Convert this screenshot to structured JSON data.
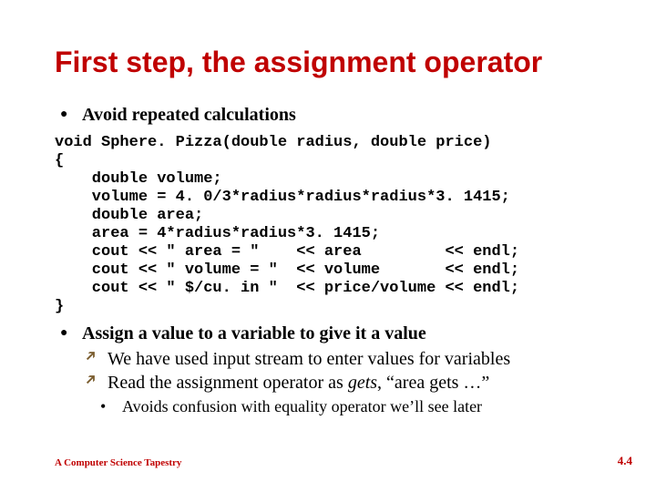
{
  "title": "First step, the assignment operator",
  "bullets": {
    "b1": "Avoid repeated calculations",
    "b2": "Assign a value to a variable to give it a value",
    "b2_sub1": "We have used input stream to enter values for variables",
    "b2_sub2_lead": "Read the assignment operator as ",
    "b2_sub2_gets": "gets",
    "b2_sub2_tail": ", “area gets …”",
    "b2_sub3": "Avoids confusion with equality operator we’ll see later"
  },
  "code_lines": [
    "void Sphere. Pizza(double radius, double price)",
    "{",
    "    double volume;",
    "    volume = 4. 0/3*radius*radius*radius*3. 1415;",
    "    double area;",
    "    area = 4*radius*radius*3. 1415;",
    "    cout << \" area = \"    << area         << endl;",
    "    cout << \" volume = \"  << volume       << endl;",
    "    cout << \" $/cu. in \"  << price/volume << endl;",
    "}"
  ],
  "footer": "A Computer Science Tapestry",
  "page_number": "4.4"
}
